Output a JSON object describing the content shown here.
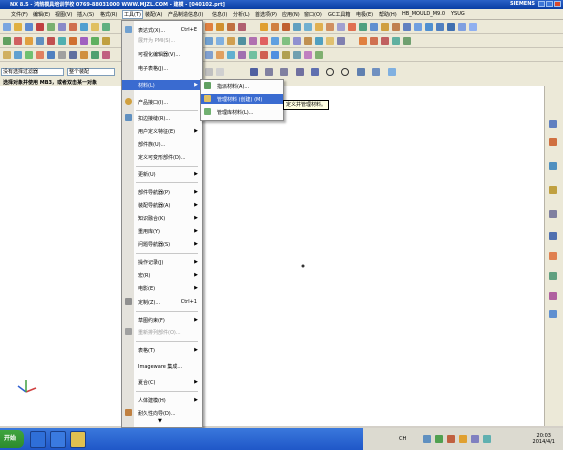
{
  "window": {
    "title": "NX 8.5 - 鸿鹄模具培训学校 0769-88031000 WWW.MJZL.COM - 建模 - [040102.prt]",
    "brand": "SIEMENS"
  },
  "menubar": {
    "items": [
      "文件(F)",
      "编辑(E)",
      "视图(V)",
      "插入(S)",
      "格式(R)",
      "工具(T)",
      "装配(A)",
      "产品制造信息(I)",
      "信息(I)",
      "分析(L)",
      "首选项(P)",
      "应用(N)",
      "窗口(O)",
      "GC工具箱",
      "电极(E)",
      "帮助(H)",
      "HB_MOULD_M9.0",
      "YSUG"
    ]
  },
  "filter": {
    "value": "没有选择过滤器",
    "assembly_value": "整个装配"
  },
  "status": {
    "prompt": "选择对象并使用 MB3，或者双击某一对象"
  },
  "tools_menu": {
    "items": [
      {
        "label": "表达式(X)...",
        "shortcut": "Ctrl+E",
        "disabled": false
      },
      {
        "label": "展开为 PMI(S)...",
        "shortcut": "",
        "disabled": true
      },
      {
        "label": "可视化编辑器(V)...",
        "shortcut": "",
        "disabled": false
      },
      {
        "label": "电子表格(J)...",
        "shortcut": "",
        "disabled": false
      },
      {
        "label": "材料(L)",
        "shortcut": "",
        "disabled": false,
        "submenu": true,
        "active": true
      },
      {
        "label": "产品接口(I)...",
        "shortcut": "",
        "disabled": false
      },
      {
        "label": "扣边接缝(R)...",
        "shortcut": "",
        "disabled": false
      },
      {
        "label": "用户定义特征(E)",
        "shortcut": "",
        "disabled": false,
        "submenu": true
      },
      {
        "label": "部件族(U)...",
        "shortcut": "",
        "disabled": false
      },
      {
        "label": "定义可变形部件(D)...",
        "shortcut": "",
        "disabled": false
      },
      {
        "label": "更新(U)",
        "shortcut": "",
        "disabled": false,
        "submenu": true
      },
      {
        "label": "部件导航器(P)",
        "shortcut": "",
        "disabled": false,
        "submenu": true
      },
      {
        "label": "装配导航器(A)",
        "shortcut": "",
        "disabled": false,
        "submenu": true
      },
      {
        "label": "知识融合(K)",
        "shortcut": "",
        "disabled": false,
        "submenu": true
      },
      {
        "label": "重用库(Y)",
        "shortcut": "",
        "disabled": false,
        "submenu": true
      },
      {
        "label": "问题导航器(S)",
        "shortcut": "",
        "disabled": false,
        "submenu": true
      },
      {
        "label": "操作记录(J)",
        "shortcut": "",
        "disabled": false,
        "submenu": true
      },
      {
        "label": "宏(R)",
        "shortcut": "",
        "disabled": false,
        "submenu": true
      },
      {
        "label": "电影(E)",
        "shortcut": "",
        "disabled": false,
        "submenu": true
      },
      {
        "label": "定制(Z)...",
        "shortcut": "Ctrl+1",
        "disabled": false
      },
      {
        "label": "草图约束(F)",
        "shortcut": "",
        "disabled": false,
        "submenu": true
      },
      {
        "label": "重新排列部件(O)...",
        "shortcut": "",
        "disabled": true
      },
      {
        "label": "表格(T)",
        "shortcut": "",
        "disabled": false,
        "submenu": true
      },
      {
        "label": "Imageware 集成...",
        "shortcut": "",
        "disabled": false
      },
      {
        "label": "夏合(C)",
        "shortcut": "",
        "disabled": false,
        "submenu": true
      },
      {
        "label": "人体建模(H)",
        "shortcut": "",
        "disabled": false,
        "submenu": true
      },
      {
        "label": "耐久性向导(D)...",
        "shortcut": "",
        "disabled": false
      }
    ]
  },
  "material_submenu": {
    "items": [
      "指派材料(A)...",
      "管理材料 (创建) (M)",
      "管理库材料(L)..."
    ]
  },
  "tooltip": {
    "text": "定义并管理材料。"
  },
  "taskbar": {
    "start_label": "开始",
    "clock_time": "20:03",
    "clock_date": "2014/4/1",
    "tray_text": "CH"
  }
}
